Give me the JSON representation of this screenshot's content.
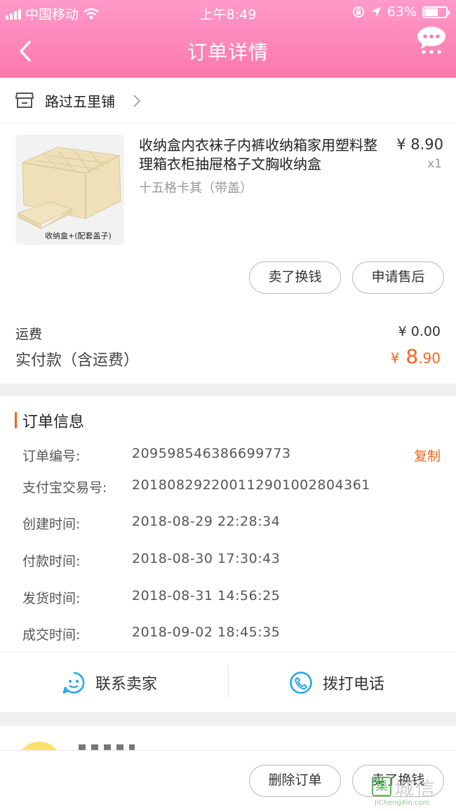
{
  "status_bar": {
    "carrier": "中国移动",
    "time": "上午8:49",
    "battery": "63%",
    "battery_level": 0.63
  },
  "nav": {
    "title": "订单详情"
  },
  "shop": {
    "name": "路过五里铺"
  },
  "product": {
    "title": "收纳盒内衣袜子内裤收纳箱家用塑料整理箱衣柜抽屉格子文胸收纳盒",
    "spec": "十五格卡其（带盖）",
    "price": "¥ 8.90",
    "qty": "x1",
    "image_caption": "收纳盒+(配套盖子)"
  },
  "item_actions": {
    "sell": "卖了换钱",
    "after_sale": "申请售后"
  },
  "fees": {
    "shipping_label": "运费",
    "shipping_value": "¥ 0.00",
    "paid_label": "实付款（含运费）",
    "paid_currency": "¥",
    "paid_int": "8",
    "paid_dec": ".90"
  },
  "order_info": {
    "section_title": "订单信息",
    "copy_label": "复制",
    "rows": [
      {
        "label": "订单编号:",
        "value": "2095985463866997​73"
      },
      {
        "label": "支付宝交易号:",
        "value": "2018082922001129010028​04361"
      },
      {
        "label": "创建时间:",
        "value": "2018-08-29 22:28:34"
      },
      {
        "label": "付款时间:",
        "value": "2018-08-30 17:30:43"
      },
      {
        "label": "发货时间:",
        "value": "2018-08-31 14:56:25"
      },
      {
        "label": "成交时间:",
        "value": "2018-09-02 18:45:35"
      }
    ]
  },
  "contact": {
    "seller": "联系卖家",
    "call": "拨打电话"
  },
  "bottom": {
    "delete": "删除订单",
    "sell": "卖了换钱"
  },
  "watermark": {
    "cn": "城信",
    "box": "集",
    "en": "JiChengXin.com"
  },
  "colors": {
    "header": "#fb78ad",
    "accent": "#f5651f",
    "icon_blue": "#29a4e8"
  }
}
